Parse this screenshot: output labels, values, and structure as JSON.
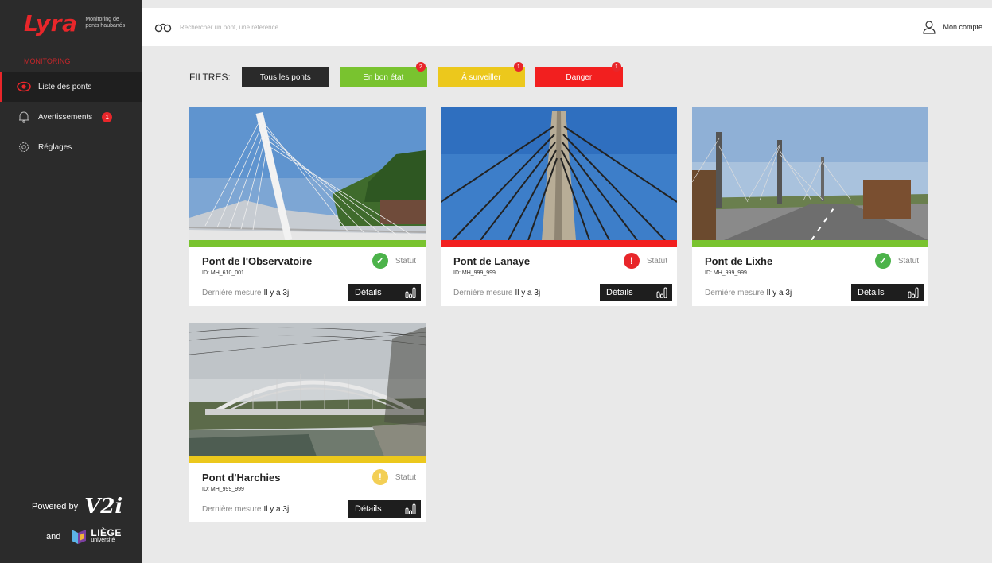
{
  "sidebar": {
    "brand": "Lyra",
    "tagline": "Monitoring de ponts haubanés",
    "section": "MONITORING",
    "items": [
      {
        "label": "Liste des ponts",
        "icon": "eye-icon",
        "active": true
      },
      {
        "label": "Avertissements",
        "icon": "bell-icon",
        "badge": "1"
      },
      {
        "label": "Réglages",
        "icon": "gear-icon"
      }
    ],
    "powered_by": "Powered by",
    "v2i": "V2i",
    "and": "and",
    "uliege": "LIÈGE",
    "uliege_sub": "université"
  },
  "header": {
    "search_placeholder": "Rechercher un pont, une référence",
    "account": "Mon compte"
  },
  "filters": {
    "label": "FILTRES:",
    "buttons": [
      {
        "label": "Tous les ponts",
        "color": "#2a2a2a"
      },
      {
        "label": "En bon état",
        "color": "#79c32f",
        "count": "2"
      },
      {
        "label": "À surveiller",
        "color": "#ecc81c",
        "count": "1"
      },
      {
        "label": "Danger",
        "color": "#f21f1f",
        "count": "1"
      }
    ]
  },
  "bridges": [
    {
      "name": "Pont de l'Observatoire",
      "id": "ID: MH_610_001",
      "status": "ok",
      "status_label": "Statut",
      "last_label": "Dernière mesure",
      "last_value": "Il y a 3j",
      "details": "Détails",
      "color": "#79c32f"
    },
    {
      "name": "Pont de Lanaye",
      "id": "ID: MH_999_999",
      "status": "danger",
      "status_label": "Statut",
      "last_label": "Dernière mesure",
      "last_value": "Il y a 3j",
      "details": "Détails",
      "color": "#f21f1f"
    },
    {
      "name": "Pont de Lixhe",
      "id": "ID: MH_999_999",
      "status": "ok",
      "status_label": "Statut",
      "last_label": "Dernière mesure",
      "last_value": "Il y a 3j",
      "details": "Détails",
      "color": "#79c32f"
    },
    {
      "name": "Pont d'Harchies",
      "id": "ID: MH_999_999",
      "status": "warn",
      "status_label": "Statut",
      "last_label": "Dernière mesure",
      "last_value": "Il y a 3j",
      "details": "Détails",
      "color": "#ecc81c"
    }
  ]
}
